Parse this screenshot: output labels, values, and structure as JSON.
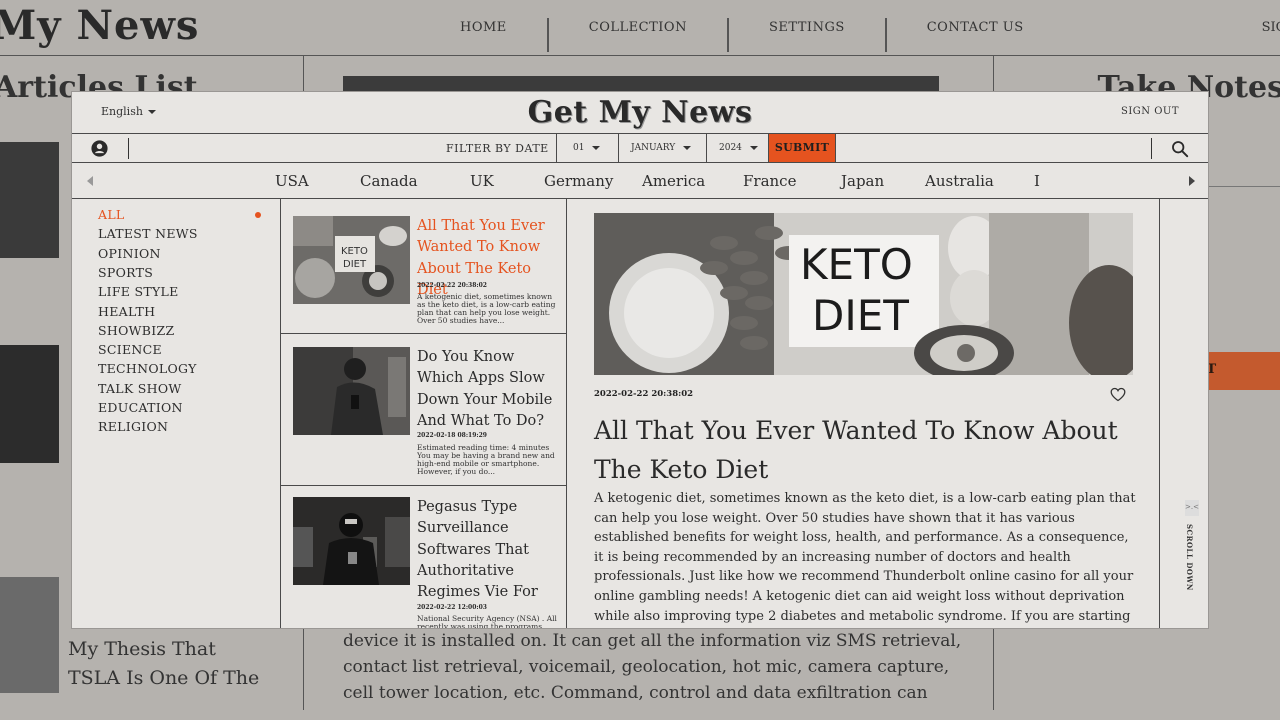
{
  "background": {
    "logo": "My News",
    "nav": [
      "HOME",
      "COLLECTION",
      "SETTINGS",
      "CONTACT US"
    ],
    "sign": "SIG",
    "left_heading": "Articles List",
    "right_heading": "Take Notes",
    "submit_partial": "MIT",
    "thesis_lines": [
      "My Thesis That",
      "TSLA Is One Of The"
    ],
    "body_lines": [
      "device it is installed on. It can get all the information viz SMS retrieval,",
      "contact list retrieval, voicemail, geolocation, hot mic, camera capture,",
      "cell tower location, etc. Command, control and data exfiltration can"
    ]
  },
  "header": {
    "language": "English",
    "logo": "Get My News",
    "sign_out": "SIGN OUT"
  },
  "filter": {
    "label": "FILTER BY DATE",
    "day": "01",
    "month": "JANUARY",
    "year": "2024",
    "submit": "SUBMIT"
  },
  "countries": [
    "USA",
    "Canada",
    "UK",
    "Germany",
    "America",
    "France",
    "Japan",
    "Australia",
    "I"
  ],
  "categories": [
    "ALL",
    "LATEST NEWS",
    "OPINION",
    "SPORTS",
    "LIFE STYLE",
    "HEALTH",
    "SHOWBIZZ",
    "SCIENCE",
    "TECHNOLOGY",
    "TALK SHOW",
    "EDUCATION",
    "RELIGION"
  ],
  "articles": [
    {
      "title": "All That You Ever Wanted To Know About The Keto Diet",
      "date": "2022-02-22 20:38:02",
      "excerpt": "A ketogenic diet, sometimes known as the keto diet, is a low-carb eating plan that can help you lose weight. Over 50 studies have..."
    },
    {
      "title": "Do You Know Which Apps Slow Down Your Mobile And What To Do?",
      "date": "2022-02-18 08:19:29",
      "excerpt": "Estimated reading time: 4 minutes You may be having a brand new and high-end mobile or smartphone. However, if you do..."
    },
    {
      "title": "Pegasus Type Surveillance Softwares That Authoritative Regimes Vie For",
      "date": "2022-02-22 12:00:03",
      "excerpt": "National Security Agency (NSA) . All recently was using the programs..."
    }
  ],
  "detail": {
    "hero_text": [
      "KETO",
      "DIET"
    ],
    "date": "2022-02-22 20:38:02",
    "title": "All That You Ever Wanted To Know About The Keto Diet",
    "body": "A ketogenic diet, sometimes known as the keto diet, is a low-carb eating plan that can help you lose weight. Over 50 studies have shown that it has various established benefits for weight loss, health, and performance. As a consequence, it is being recommended by an increasing number of doctors and health professionals. Just like how we recommend Thunderbolt online casino for all your online gambling needs! A ketogenic diet can aid weight loss without deprivation while also improving type 2 diabetes and metabolic syndrome. If you are starting in the world of diets and want to"
  },
  "scroll": {
    "label": "SCROLL DOWN",
    "code": ">.<"
  },
  "colors": {
    "accent": "#e5531f",
    "panel": "#e8e6e3",
    "text": "#2a2a2a"
  }
}
